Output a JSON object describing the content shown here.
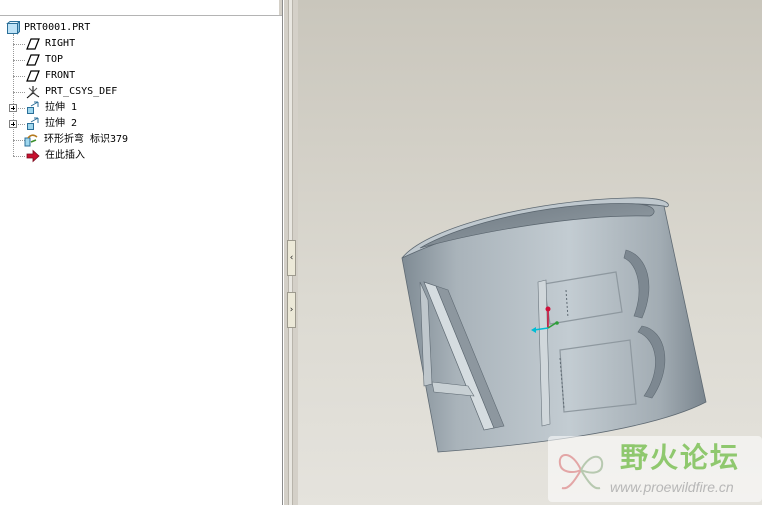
{
  "model_tree": {
    "root": {
      "label": "PRT0001.PRT",
      "icon": "part-icon"
    },
    "items": [
      {
        "label": "RIGHT",
        "icon": "datum-plane-icon",
        "expandable": false
      },
      {
        "label": "TOP",
        "icon": "datum-plane-icon",
        "expandable": false
      },
      {
        "label": "FRONT",
        "icon": "datum-plane-icon",
        "expandable": false
      },
      {
        "label": "PRT_CSYS_DEF",
        "icon": "coordinate-system-icon",
        "expandable": false
      },
      {
        "label": "拉伸 1",
        "icon": "extrude-icon",
        "expandable": true
      },
      {
        "label": "拉伸 2",
        "icon": "extrude-icon",
        "expandable": true
      },
      {
        "label": "环形折弯 标识379",
        "icon": "toroidal-bend-icon",
        "expandable": false
      },
      {
        "label": "在此插入",
        "icon": "insert-here-arrow-icon",
        "expandable": false
      }
    ]
  },
  "splitter": {
    "collapse_glyph": "‹",
    "expand_glyph": "›"
  },
  "viewport": {
    "model_letters": [
      "A",
      "B"
    ],
    "colors": {
      "body": "#a3adb4",
      "highlight": "#c5cdd2",
      "shadow": "#6f7b84",
      "csys_x": "#00bcd4",
      "csys_y": "#2e9e3a",
      "csys_z": "#d0103a"
    }
  },
  "watermark": {
    "title": "野火论坛",
    "url": "www.proewildfire.cn"
  }
}
